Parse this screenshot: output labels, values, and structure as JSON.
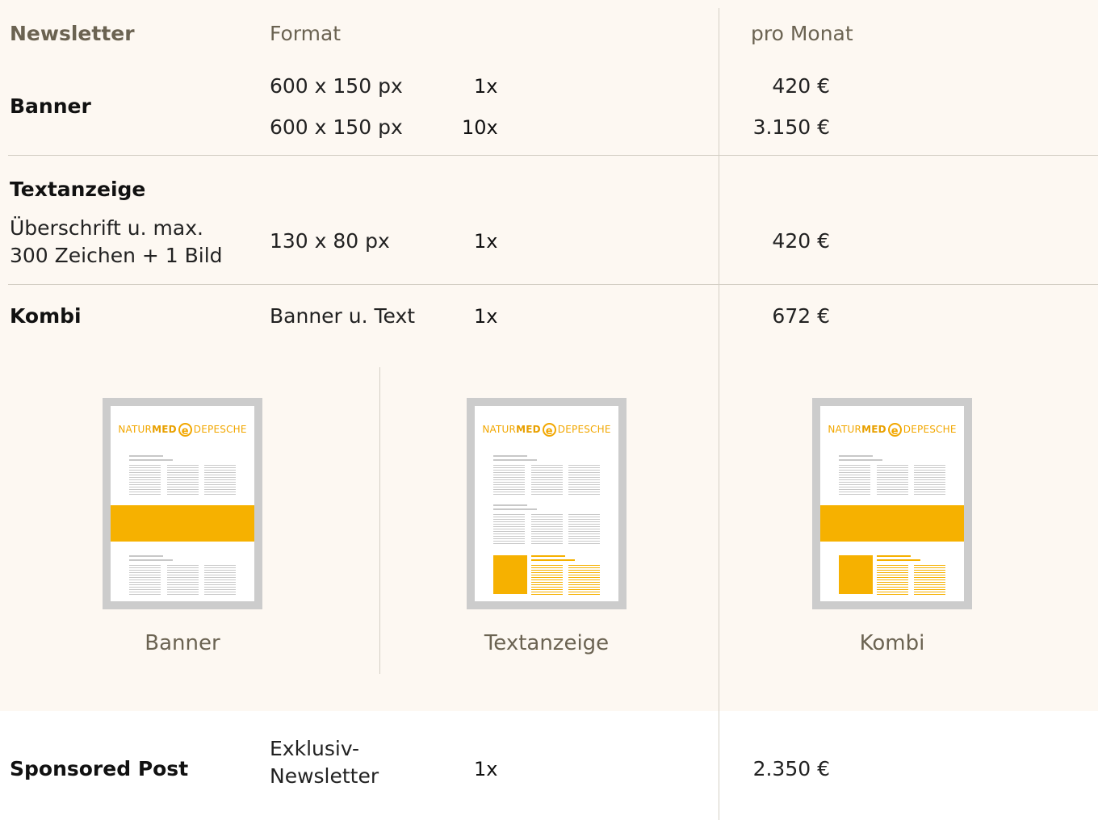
{
  "header": {
    "newsletter": "Newsletter",
    "format": "Format",
    "per_month": "pro Monat"
  },
  "rows": {
    "banner": {
      "label": "Banner",
      "lines": [
        {
          "format": "600 x 150 px",
          "qty": "1x",
          "price": "420 €"
        },
        {
          "format": "600 x 150 px",
          "qty": "10x",
          "price": "3.150 €"
        }
      ]
    },
    "textanzeige": {
      "label": "Textanzeige",
      "desc_line1": "Überschrift u. max.",
      "desc_line2": "300 Zeichen + 1 Bild",
      "format": "130 x 80 px",
      "qty": "1x",
      "price": "420 €"
    },
    "kombi": {
      "label": "Kombi",
      "format": "Banner u. Text",
      "qty": "1x",
      "price": "672 €"
    },
    "sponsored": {
      "label": "Sponsored Post",
      "format_line1": "Exklusiv-",
      "format_line2": "Newsletter",
      "qty": "1x",
      "price": "2.350 €"
    }
  },
  "mockups": {
    "logo_prefix": "NATUR",
    "logo_bold": "MED",
    "logo_e": "e",
    "logo_suffix": "DEPESCHE",
    "captions": [
      "Banner",
      "Textanzeige",
      "Kombi"
    ]
  },
  "colors": {
    "accent": "#f6b100",
    "background": "#fdf8f2",
    "heading": "#6b6352",
    "frame": "#cccccc"
  }
}
